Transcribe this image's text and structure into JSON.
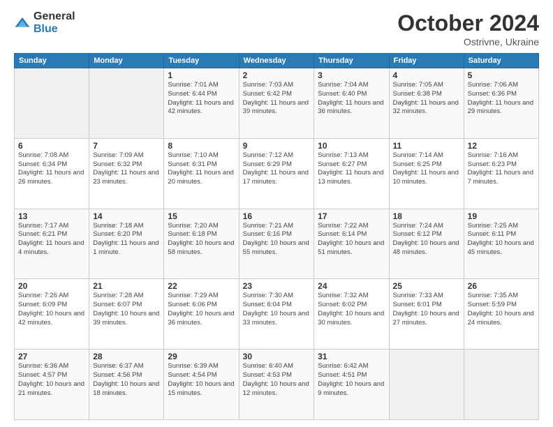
{
  "logo": {
    "general": "General",
    "blue": "Blue"
  },
  "title": {
    "month": "October 2024",
    "location": "Ostrivne, Ukraine"
  },
  "weekdays": [
    "Sunday",
    "Monday",
    "Tuesday",
    "Wednesday",
    "Thursday",
    "Friday",
    "Saturday"
  ],
  "weeks": [
    [
      {
        "day": "",
        "info": ""
      },
      {
        "day": "",
        "info": ""
      },
      {
        "day": "1",
        "info": "Sunrise: 7:01 AM\nSunset: 6:44 PM\nDaylight: 11 hours and 42 minutes."
      },
      {
        "day": "2",
        "info": "Sunrise: 7:03 AM\nSunset: 6:42 PM\nDaylight: 11 hours and 39 minutes."
      },
      {
        "day": "3",
        "info": "Sunrise: 7:04 AM\nSunset: 6:40 PM\nDaylight: 11 hours and 36 minutes."
      },
      {
        "day": "4",
        "info": "Sunrise: 7:05 AM\nSunset: 6:38 PM\nDaylight: 11 hours and 32 minutes."
      },
      {
        "day": "5",
        "info": "Sunrise: 7:06 AM\nSunset: 6:36 PM\nDaylight: 11 hours and 29 minutes."
      }
    ],
    [
      {
        "day": "6",
        "info": "Sunrise: 7:08 AM\nSunset: 6:34 PM\nDaylight: 11 hours and 26 minutes."
      },
      {
        "day": "7",
        "info": "Sunrise: 7:09 AM\nSunset: 6:32 PM\nDaylight: 11 hours and 23 minutes."
      },
      {
        "day": "8",
        "info": "Sunrise: 7:10 AM\nSunset: 6:31 PM\nDaylight: 11 hours and 20 minutes."
      },
      {
        "day": "9",
        "info": "Sunrise: 7:12 AM\nSunset: 6:29 PM\nDaylight: 11 hours and 17 minutes."
      },
      {
        "day": "10",
        "info": "Sunrise: 7:13 AM\nSunset: 6:27 PM\nDaylight: 11 hours and 13 minutes."
      },
      {
        "day": "11",
        "info": "Sunrise: 7:14 AM\nSunset: 6:25 PM\nDaylight: 11 hours and 10 minutes."
      },
      {
        "day": "12",
        "info": "Sunrise: 7:16 AM\nSunset: 6:23 PM\nDaylight: 11 hours and 7 minutes."
      }
    ],
    [
      {
        "day": "13",
        "info": "Sunrise: 7:17 AM\nSunset: 6:21 PM\nDaylight: 11 hours and 4 minutes."
      },
      {
        "day": "14",
        "info": "Sunrise: 7:18 AM\nSunset: 6:20 PM\nDaylight: 11 hours and 1 minute."
      },
      {
        "day": "15",
        "info": "Sunrise: 7:20 AM\nSunset: 6:18 PM\nDaylight: 10 hours and 58 minutes."
      },
      {
        "day": "16",
        "info": "Sunrise: 7:21 AM\nSunset: 6:16 PM\nDaylight: 10 hours and 55 minutes."
      },
      {
        "day": "17",
        "info": "Sunrise: 7:22 AM\nSunset: 6:14 PM\nDaylight: 10 hours and 51 minutes."
      },
      {
        "day": "18",
        "info": "Sunrise: 7:24 AM\nSunset: 6:12 PM\nDaylight: 10 hours and 48 minutes."
      },
      {
        "day": "19",
        "info": "Sunrise: 7:25 AM\nSunset: 6:11 PM\nDaylight: 10 hours and 45 minutes."
      }
    ],
    [
      {
        "day": "20",
        "info": "Sunrise: 7:26 AM\nSunset: 6:09 PM\nDaylight: 10 hours and 42 minutes."
      },
      {
        "day": "21",
        "info": "Sunrise: 7:28 AM\nSunset: 6:07 PM\nDaylight: 10 hours and 39 minutes."
      },
      {
        "day": "22",
        "info": "Sunrise: 7:29 AM\nSunset: 6:06 PM\nDaylight: 10 hours and 36 minutes."
      },
      {
        "day": "23",
        "info": "Sunrise: 7:30 AM\nSunset: 6:04 PM\nDaylight: 10 hours and 33 minutes."
      },
      {
        "day": "24",
        "info": "Sunrise: 7:32 AM\nSunset: 6:02 PM\nDaylight: 10 hours and 30 minutes."
      },
      {
        "day": "25",
        "info": "Sunrise: 7:33 AM\nSunset: 6:01 PM\nDaylight: 10 hours and 27 minutes."
      },
      {
        "day": "26",
        "info": "Sunrise: 7:35 AM\nSunset: 5:59 PM\nDaylight: 10 hours and 24 minutes."
      }
    ],
    [
      {
        "day": "27",
        "info": "Sunrise: 6:36 AM\nSunset: 4:57 PM\nDaylight: 10 hours and 21 minutes."
      },
      {
        "day": "28",
        "info": "Sunrise: 6:37 AM\nSunset: 4:56 PM\nDaylight: 10 hours and 18 minutes."
      },
      {
        "day": "29",
        "info": "Sunrise: 6:39 AM\nSunset: 4:54 PM\nDaylight: 10 hours and 15 minutes."
      },
      {
        "day": "30",
        "info": "Sunrise: 6:40 AM\nSunset: 4:53 PM\nDaylight: 10 hours and 12 minutes."
      },
      {
        "day": "31",
        "info": "Sunrise: 6:42 AM\nSunset: 4:51 PM\nDaylight: 10 hours and 9 minutes."
      },
      {
        "day": "",
        "info": ""
      },
      {
        "day": "",
        "info": ""
      }
    ]
  ]
}
